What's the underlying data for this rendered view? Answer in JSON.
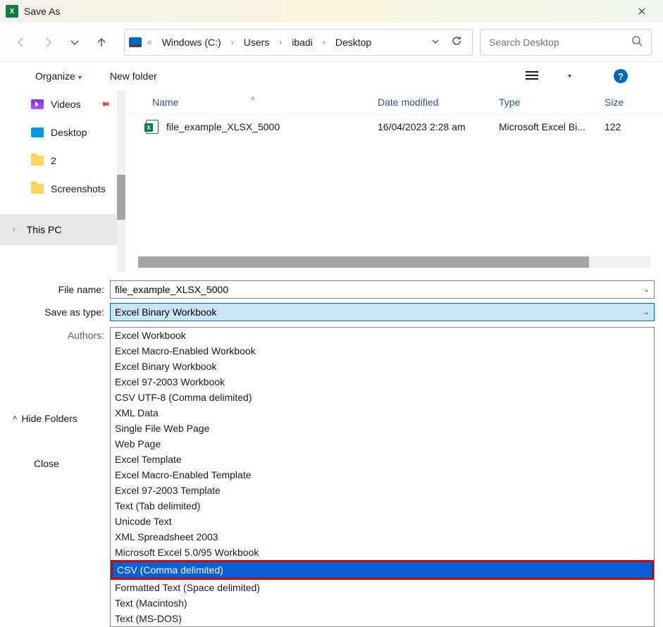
{
  "window": {
    "title": "Save As"
  },
  "nav": {
    "crumbs": [
      "Windows (C:)",
      "Users",
      "ibadi",
      "Desktop"
    ]
  },
  "search": {
    "placeholder": "Search Desktop"
  },
  "toolbar": {
    "organize": "Organize",
    "newfolder": "New folder"
  },
  "sidebar": {
    "items": [
      {
        "label": "Videos"
      },
      {
        "label": "Desktop"
      },
      {
        "label": "2"
      },
      {
        "label": "Screenshots"
      }
    ],
    "thispc": "This PC"
  },
  "columns": {
    "name": "Name",
    "date": "Date modified",
    "type": "Type",
    "size": "Size"
  },
  "files": [
    {
      "name": "file_example_XLSX_5000",
      "date": "16/04/2023 2:28 am",
      "type": "Microsoft Excel Bi...",
      "size": "122"
    }
  ],
  "fields": {
    "filename_label": "File name:",
    "filename_value": "file_example_XLSX_5000",
    "type_label": "Save as type:",
    "type_value": "Excel Binary Workbook",
    "authors_label": "Authors:"
  },
  "type_options": [
    "Excel Workbook",
    "Excel Macro-Enabled Workbook",
    "Excel Binary Workbook",
    "Excel 97-2003 Workbook",
    "CSV UTF-8 (Comma delimited)",
    "XML Data",
    "Single File Web Page",
    "Web Page",
    "Excel Template",
    "Excel Macro-Enabled Template",
    "Excel 97-2003 Template",
    "Text (Tab delimited)",
    "Unicode Text",
    "XML Spreadsheet 2003",
    "Microsoft Excel 5.0/95 Workbook",
    "CSV (Comma delimited)",
    "Formatted Text (Space delimited)",
    "Text (Macintosh)",
    "Text (MS-DOS)"
  ],
  "selected_option": "CSV (Comma delimited)",
  "footer": {
    "hide_folders": "Hide Folders",
    "close": "Close"
  }
}
